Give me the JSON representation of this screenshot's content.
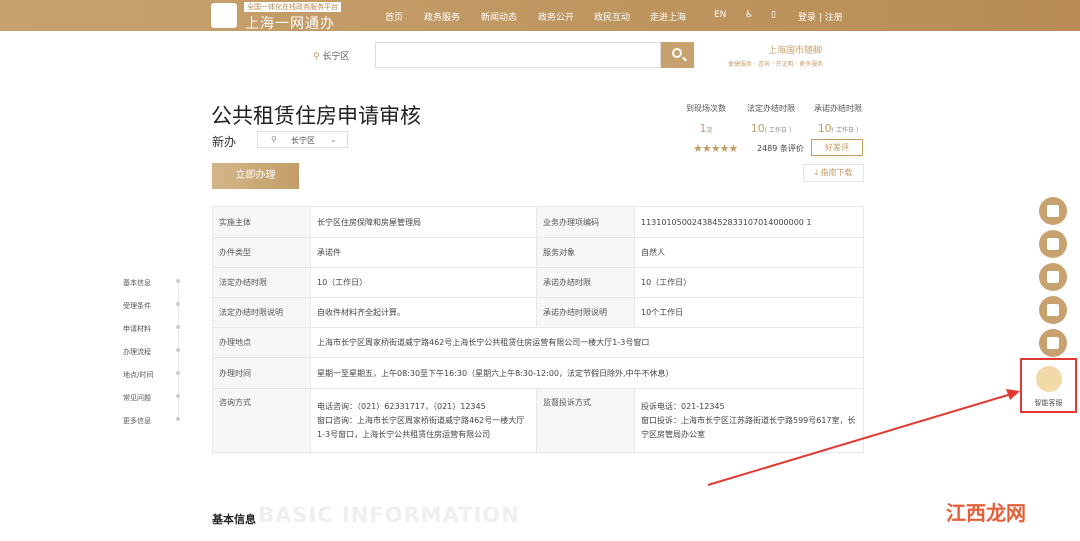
{
  "header": {
    "logo_sub": "全国一体化在线政务服务平台",
    "logo_title": "上海一网通办",
    "nav": [
      "首页",
      "政务服务",
      "新闻动态",
      "政务公开",
      "政民互动",
      "走进上海",
      "EN"
    ],
    "login": "登录 | 注册"
  },
  "search": {
    "district": "长宁区",
    "placeholder": "",
    "quick_title": "上海国市随脚",
    "quick_links": "便捷服务 · 咨询 · 开证明 · 更多服务"
  },
  "item": {
    "title": "公共租赁住房申请审核",
    "type": "新办",
    "district": "长宁区",
    "apply_label": "立即办理"
  },
  "stats": [
    {
      "label": "到现场次数",
      "value": "1",
      "unit": "次"
    },
    {
      "label": "法定办结时限",
      "value": "10",
      "unit": "( 工作日 )"
    },
    {
      "label": "承诺办结时限",
      "value": "10",
      "unit": "( 工作日 )"
    }
  ],
  "rating": {
    "stars": "★★★★★",
    "text": "2489 条评价",
    "good_btn": "好差评",
    "download": "指南下载"
  },
  "table": [
    [
      "实施主体",
      "长宁区住房保障和房屋管理局",
      "业务办理项编码",
      "11310105002438452833107014000000 1"
    ],
    [
      "办件类型",
      "承诺件",
      "服务对象",
      "自然人"
    ],
    [
      "法定办结时限",
      "10（工作日）",
      "承诺办结时限",
      "10（工作日）"
    ],
    [
      "法定办结时限说明",
      "自收件材料齐全起计算。",
      "承诺办结时限说明",
      "10个工作日"
    ]
  ],
  "table_wide": [
    [
      "办理地点",
      "上海市长宁区周家桥街道威宁路462号上海长宁公共租赁住房运营有限公司一楼大厅1-3号窗口"
    ],
    [
      "办理时间",
      "星期一至星期五，上午08:30至下午16:30（星期六上午8:30-12:00，法定节假日除外,中午不休息）"
    ]
  ],
  "consult": {
    "label": "咨询方式",
    "phone": "电话咨询：（021）62331717，（021）12345",
    "window": "窗口咨询：上海市长宁区周家桥街道威宁路462号一楼大厅1-3号窗口，上海长宁公共租赁住房运营有限公司",
    "complain_label": "监督投诉方式",
    "complain_phone": "投诉电话：021-12345",
    "complain_window": "窗口投诉：上海市长宁区江苏路街道长宁路599号617室，长宁区房管局办公室"
  },
  "sidenav": [
    "基本信息",
    "受理条件",
    "申请材料",
    "办理流程",
    "地点/时间",
    "常见问题",
    "更多信息"
  ],
  "section": {
    "title": "基本信息",
    "title_en": "BASIC INFORMATION"
  },
  "assistant": {
    "label": "智能客服"
  },
  "watermark": "江西龙网"
}
